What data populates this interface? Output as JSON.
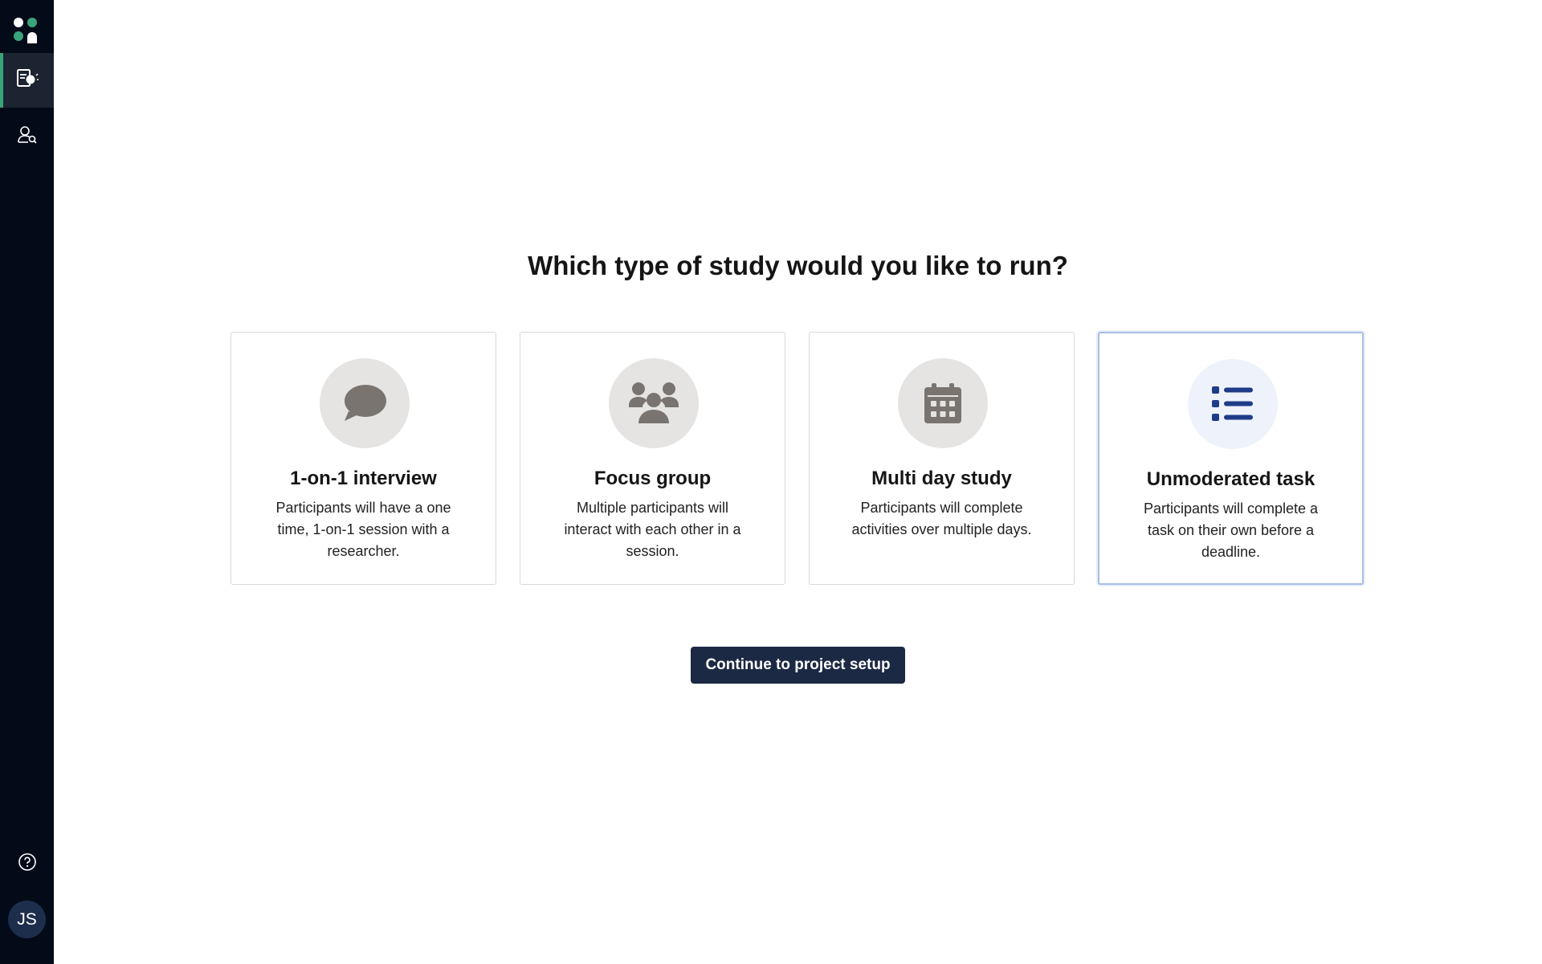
{
  "sidebar": {
    "nav": [
      {
        "icon": "projects-icon",
        "active": true
      },
      {
        "icon": "participants-icon",
        "active": false
      }
    ],
    "help_icon": "help-icon",
    "avatar_initials": "JS"
  },
  "page": {
    "title": "Which type of study would you like to run?"
  },
  "study_types": [
    {
      "icon": "speech-bubble-icon",
      "title": "1-on-1 interview",
      "description": "Participants will have a one time, 1-on-1 session with a researcher.",
      "selected": false
    },
    {
      "icon": "group-icon",
      "title": "Focus group",
      "description": "Multiple participants will interact with each other in a session.",
      "selected": false
    },
    {
      "icon": "calendar-icon",
      "title": "Multi day study",
      "description": "Participants will complete activities over multiple days.",
      "selected": false
    },
    {
      "icon": "list-icon",
      "title": "Unmoderated task",
      "description": "Participants will complete a task on their own before a deadline.",
      "selected": true
    }
  ],
  "actions": {
    "continue_label": "Continue to project setup"
  },
  "colors": {
    "sidebar_bg": "#030b19",
    "accent_green": "#3aa37a",
    "primary_button": "#1c2944",
    "selected_icon": "#1f3c88",
    "icon_gray": "#7a7470"
  }
}
